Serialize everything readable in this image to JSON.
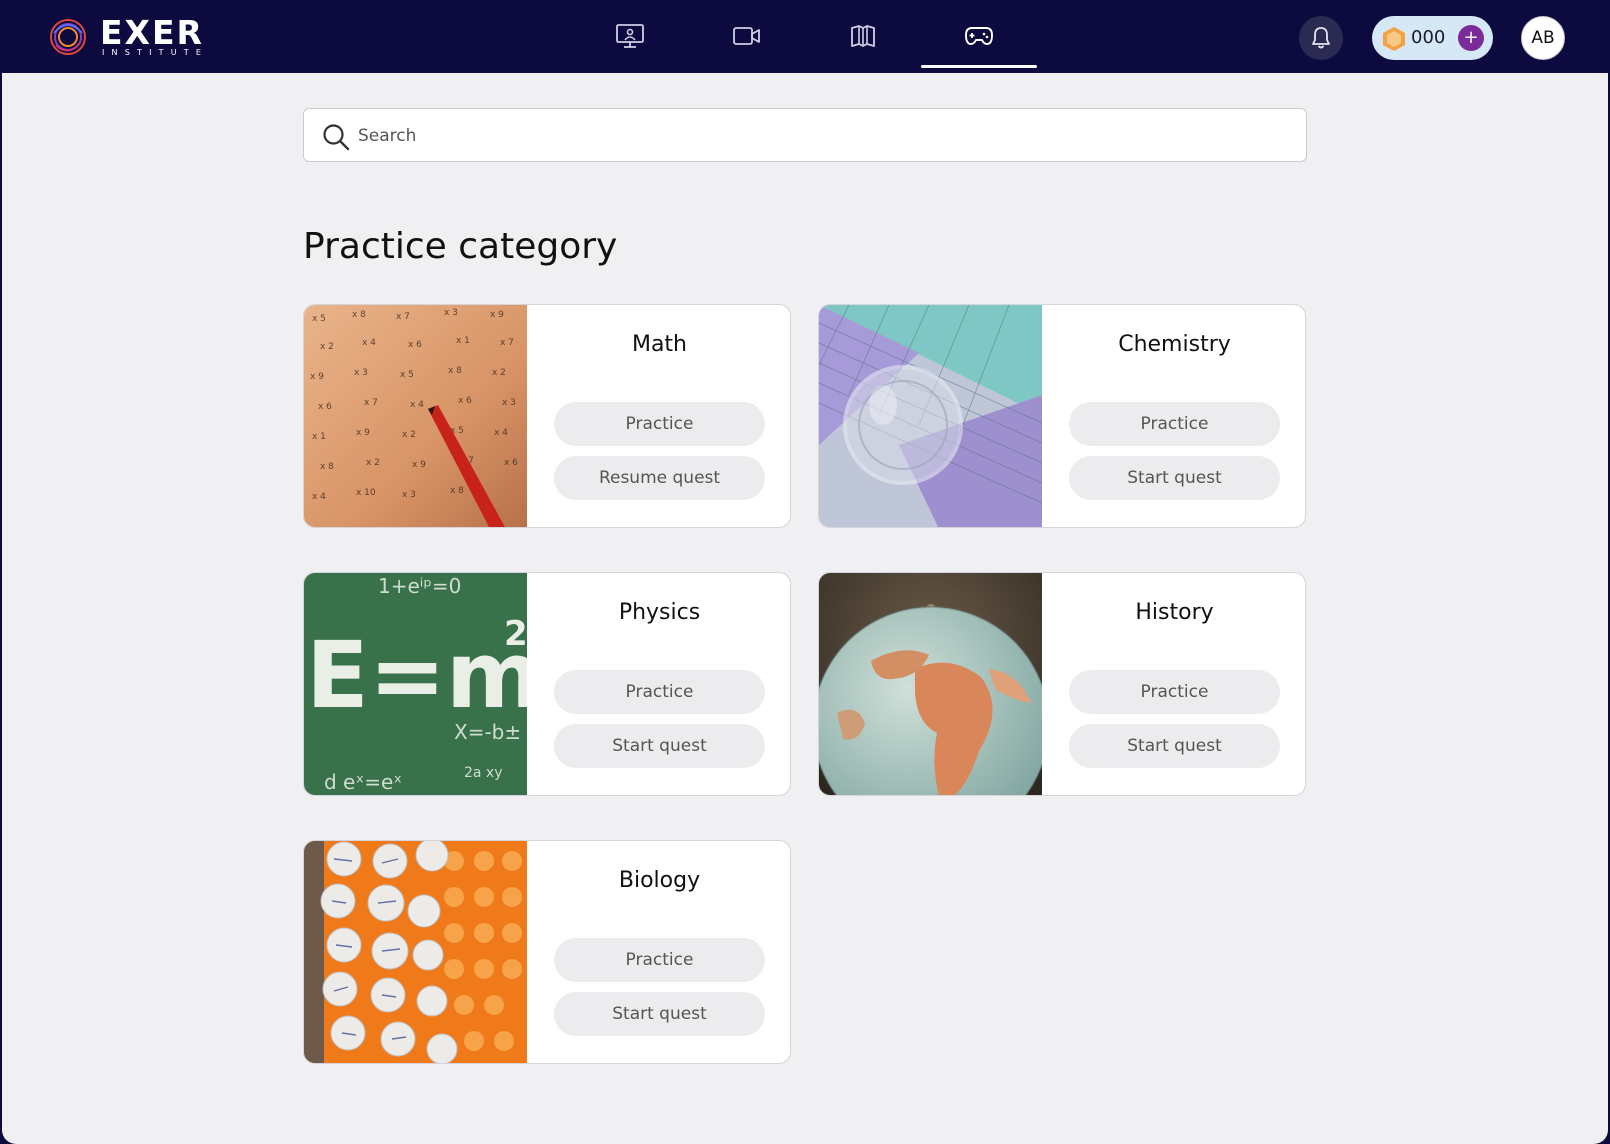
{
  "brand": {
    "name": "EXER",
    "subtitle": "INSTITUTE"
  },
  "nav": {
    "items": [
      {
        "icon": "presentation-screen-icon"
      },
      {
        "icon": "video-camera-icon"
      },
      {
        "icon": "open-book-icon"
      },
      {
        "icon": "gamepad-icon",
        "active": true
      }
    ]
  },
  "header": {
    "coins": "000",
    "coin_add": "+",
    "avatar": "AB"
  },
  "search": {
    "placeholder": "Search"
  },
  "page": {
    "title": "Practice category"
  },
  "categories": [
    {
      "title": "Math",
      "primary": "Practice",
      "secondary": "Resume quest"
    },
    {
      "title": "Chemistry",
      "primary": "Practice",
      "secondary": "Start quest"
    },
    {
      "title": "Physics",
      "primary": "Practice",
      "secondary": "Start quest"
    },
    {
      "title": "History",
      "primary": "Practice",
      "secondary": "Start quest"
    },
    {
      "title": "Biology",
      "primary": "Practice",
      "secondary": "Start quest"
    }
  ],
  "colors": {
    "header_bg": "#0c0a3e",
    "page_bg": "#f0f0f2",
    "coin_pill": "#d6e7f6",
    "coin_plus": "#7b2a9a",
    "button_bg": "#ececee"
  }
}
